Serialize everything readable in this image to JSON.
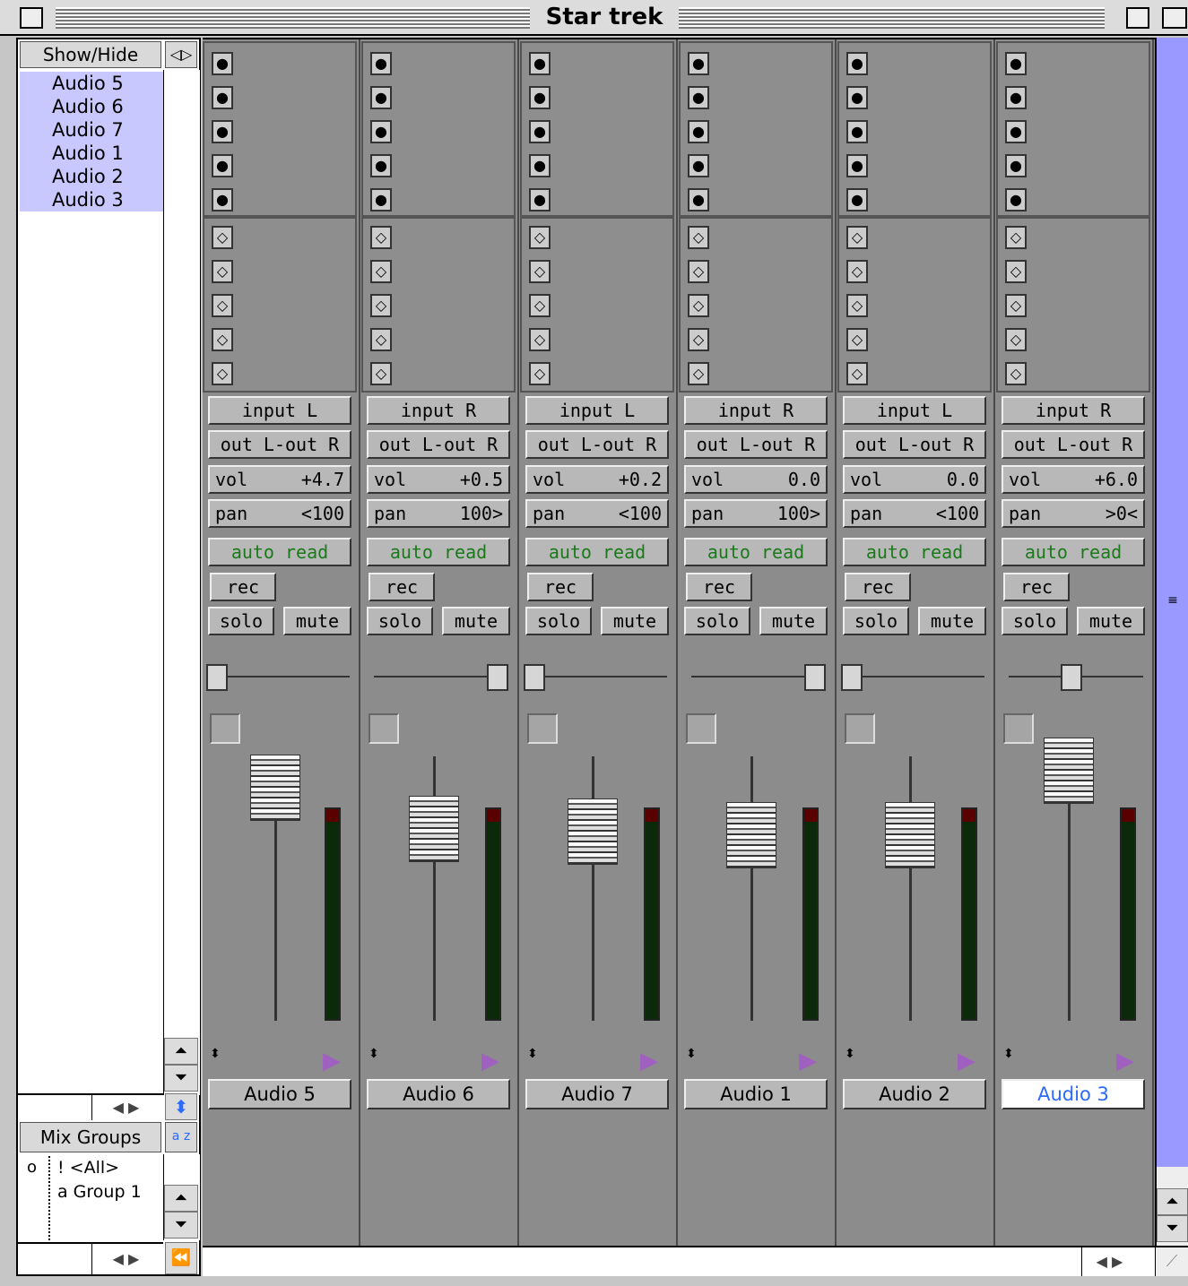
{
  "window": {
    "title": "Star trek"
  },
  "left": {
    "show_hide_label": "Show/Hide",
    "tracks": [
      "Audio 5",
      "Audio 6",
      "Audio 7",
      "Audio 1",
      "Audio 2",
      "Audio 3"
    ],
    "mix_groups_label": "Mix Groups",
    "az_label": "a z",
    "groups": [
      {
        "mark": "o",
        "name": "! <All>"
      },
      {
        "mark": "",
        "name": "a Group 1"
      }
    ]
  },
  "strips": [
    {
      "name": "Audio 5",
      "input": "input L",
      "output": "out L-out R",
      "vol_label": "vol",
      "vol": "+4.7",
      "pan_label": "pan",
      "pan": "<100",
      "auto": "auto read",
      "rec": "rec",
      "solo": "solo",
      "mute": "mute",
      "selected": false,
      "pan_pos": 0.0,
      "fader": 0.9
    },
    {
      "name": "Audio 6",
      "input": "input R",
      "output": "out L-out R",
      "vol_label": "vol",
      "vol": "+0.5",
      "pan_label": "pan",
      "pan": "100>",
      "auto": "auto read",
      "rec": "rec",
      "solo": "solo",
      "mute": "mute",
      "selected": false,
      "pan_pos": 1.0,
      "fader": 0.78
    },
    {
      "name": "Audio 7",
      "input": "input L",
      "output": "out L-out R",
      "vol_label": "vol",
      "vol": "+0.2",
      "pan_label": "pan",
      "pan": "<100",
      "auto": "auto read",
      "rec": "rec",
      "solo": "solo",
      "mute": "mute",
      "selected": false,
      "pan_pos": 0.0,
      "fader": 0.77
    },
    {
      "name": "Audio 1",
      "input": "input R",
      "output": "out L-out R",
      "vol_label": "vol",
      "vol": "0.0",
      "pan_label": "pan",
      "pan": "100>",
      "auto": "auto read",
      "rec": "rec",
      "solo": "solo",
      "mute": "mute",
      "selected": false,
      "pan_pos": 1.0,
      "fader": 0.76
    },
    {
      "name": "Audio 2",
      "input": "input L",
      "output": "out L-out R",
      "vol_label": "vol",
      "vol": "0.0",
      "pan_label": "pan",
      "pan": "<100",
      "auto": "auto read",
      "rec": "rec",
      "solo": "solo",
      "mute": "mute",
      "selected": false,
      "pan_pos": 0.0,
      "fader": 0.76
    },
    {
      "name": "Audio 3",
      "input": "input R",
      "output": "out L-out R",
      "vol_label": "vol",
      "vol": "+6.0",
      "pan_label": "pan",
      "pan": ">0<",
      "auto": "auto read",
      "rec": "rec",
      "solo": "solo",
      "mute": "mute",
      "selected": true,
      "pan_pos": 0.5,
      "fader": 0.95
    }
  ],
  "colors": {
    "track_highlight": "#c8c8ff",
    "selected_name": "#2a6aff",
    "auto_text": "#1a7a1a",
    "scroll_thumb": "#9999ff"
  }
}
